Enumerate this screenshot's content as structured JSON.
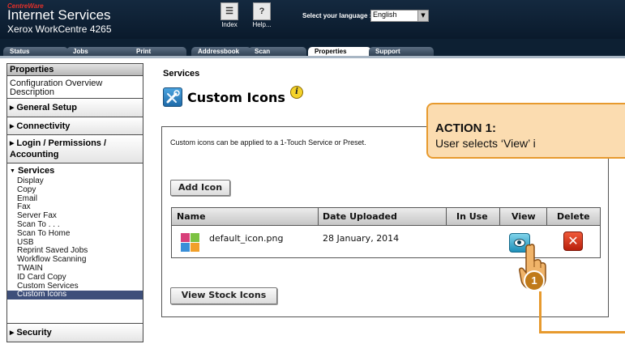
{
  "header": {
    "brand_top": "CentreWare",
    "title": "Internet Services",
    "model": "Xerox WorkCentre 4265",
    "index_label": "Index",
    "help_label": "Help...",
    "language_label": "Select your language :",
    "language_value": "English"
  },
  "tabs": [
    {
      "label": "Status"
    },
    {
      "label": "Jobs"
    },
    {
      "label": "Print"
    },
    {
      "label": "Addressbook"
    },
    {
      "label": "Scan"
    },
    {
      "label": "Properties"
    },
    {
      "label": "Support"
    }
  ],
  "sidebar": {
    "header": "Properties",
    "config_link": "Configuration Overview Description",
    "sections": {
      "general": "General Setup",
      "connectivity": "Connectivity",
      "login": "Login / Permissions / Accounting",
      "services": "Services",
      "security": "Security"
    },
    "service_items": [
      "Display",
      "Copy",
      "Email",
      "Fax",
      "Server Fax",
      "Scan To . . .",
      "Scan To Home",
      "USB",
      "Reprint Saved Jobs",
      "Workflow Scanning",
      "TWAIN",
      "ID Card Copy",
      "Custom Services",
      "Custom Icons"
    ],
    "selected_item": "Custom Icons"
  },
  "main": {
    "breadcrumb": "Services",
    "title": "Custom Icons",
    "description": "Custom icons can be applied to a 1-Touch Service or Preset.",
    "add_icon_label": "Add Icon",
    "view_stock_label": "View Stock Icons",
    "table": {
      "headers": [
        "Name",
        "Date Uploaded",
        "In Use",
        "View",
        "Delete"
      ],
      "rows": [
        {
          "name": "default_icon.png",
          "date": "28 January, 2014",
          "in_use": ""
        }
      ]
    }
  },
  "callout": {
    "title": "ACTION 1:",
    "text": "User selects ‘View’ i",
    "step_number": "1"
  },
  "icons": {
    "index": "book-icon",
    "help": "help-icon",
    "page": "tools-icon",
    "info": "info-icon",
    "view": "eye-icon",
    "delete": "close-icon",
    "pointer": "hand-pointer-icon"
  },
  "colors": {
    "header_bg": "#0a1a2c",
    "callout_bg": "#fbdcb0",
    "callout_border": "#e79a2e",
    "selected_item_bg": "#3e4f7a",
    "view_button": "#1f8fb8",
    "delete_button": "#c8280e"
  }
}
